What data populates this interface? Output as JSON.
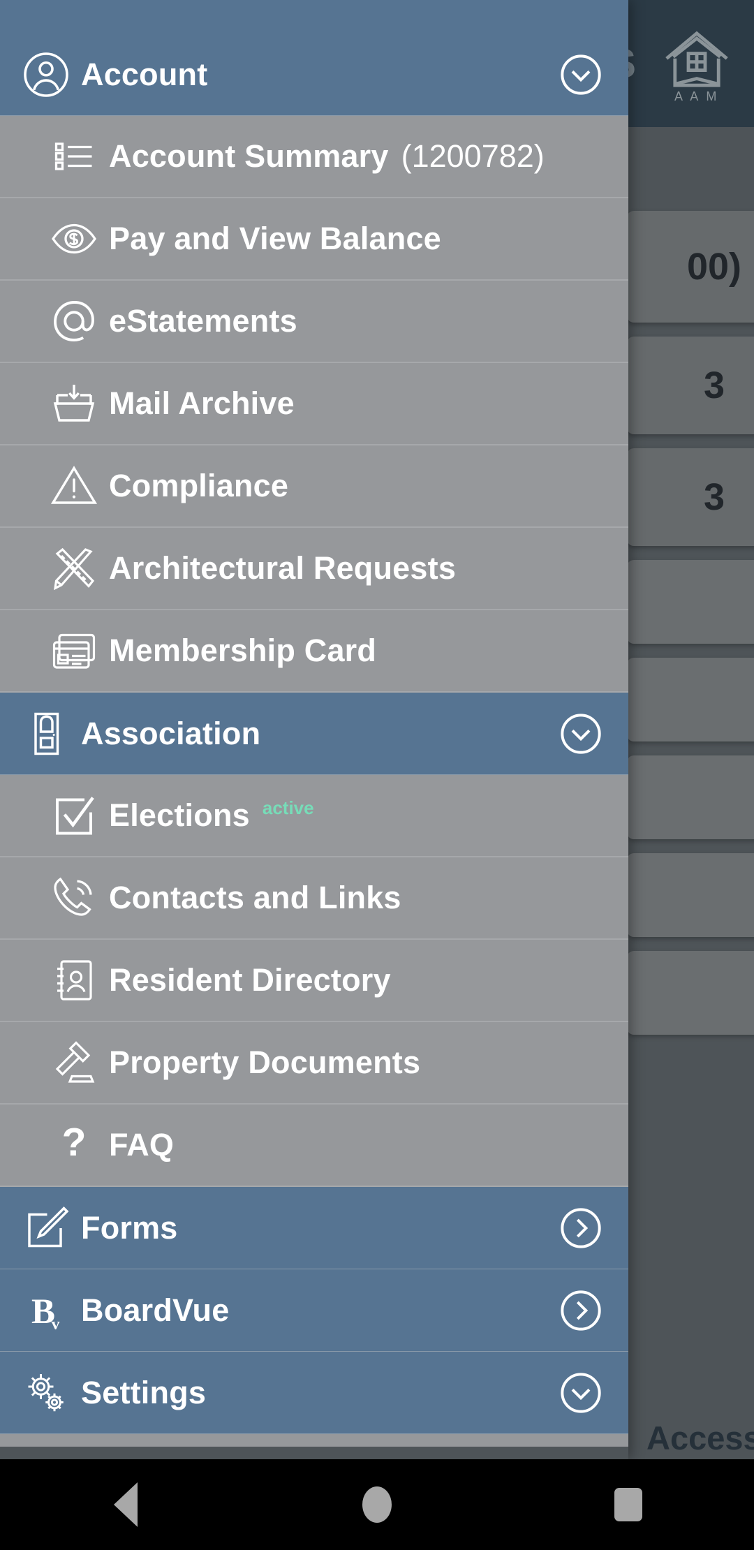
{
  "backdrop": {
    "app_title_partial": "ESS",
    "logo_text": "A A M",
    "cards": [
      {
        "text": "00)"
      },
      {
        "text": "3"
      },
      {
        "text": "3"
      },
      {
        "text": ""
      },
      {
        "text": ""
      },
      {
        "text": ""
      },
      {
        "text": ""
      },
      {
        "text": ""
      }
    ],
    "access_label": "Access"
  },
  "drawer": {
    "sections": [
      {
        "id": "account",
        "label": "Account",
        "icon": "user-circle-icon",
        "expanded": true,
        "chevron": "chevron-down-circle-icon",
        "items": [
          {
            "label": "Account Summary",
            "suffix": "(1200782)",
            "icon": "list-icon"
          },
          {
            "label": "Pay and View Balance",
            "icon": "eye-dollar-icon"
          },
          {
            "label": "eStatements",
            "icon": "at-sign-icon"
          },
          {
            "label": "Mail Archive",
            "icon": "inbox-download-icon"
          },
          {
            "label": "Compliance",
            "icon": "warning-triangle-icon"
          },
          {
            "label": "Architectural Requests",
            "icon": "ruler-pencil-icon"
          },
          {
            "label": "Membership Card",
            "icon": "id-card-icon"
          }
        ]
      },
      {
        "id": "association",
        "label": "Association",
        "icon": "door-icon",
        "expanded": true,
        "chevron": "chevron-down-circle-icon",
        "items": [
          {
            "label": "Elections",
            "badge": "active",
            "icon": "checkbox-check-icon"
          },
          {
            "label": "Contacts and Links",
            "icon": "phone-icon"
          },
          {
            "label": "Resident Directory",
            "icon": "address-book-icon"
          },
          {
            "label": "Property Documents",
            "icon": "gavel-icon"
          },
          {
            "label": "FAQ",
            "icon": "question-mark-icon"
          }
        ]
      },
      {
        "id": "forms",
        "label": "Forms",
        "icon": "edit-square-icon",
        "expanded": false,
        "chevron": "chevron-right-circle-icon",
        "items": []
      },
      {
        "id": "boardvue",
        "label": "BoardVue",
        "icon": "boardvue-logo-icon",
        "expanded": false,
        "chevron": "chevron-right-circle-icon",
        "items": []
      },
      {
        "id": "settings",
        "label": "Settings",
        "icon": "gears-icon",
        "expanded": false,
        "chevron": "chevron-down-circle-icon",
        "items": []
      }
    ]
  },
  "navbar": {
    "back": "back-icon",
    "home": "home-icon",
    "recents": "recents-icon"
  },
  "colors": {
    "section_blue": "#567492",
    "submenu_gray": "#96989b",
    "badge_green": "#77dcb8",
    "backdrop_dim": "#4e5458",
    "topbar_dark": "#2b3a45"
  }
}
